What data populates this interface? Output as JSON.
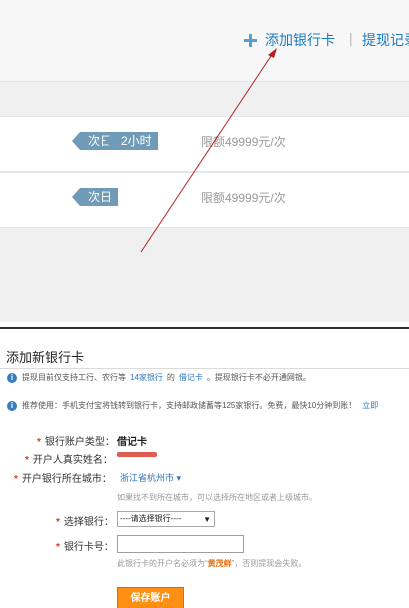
{
  "top": {
    "add_card": "添加银行卡",
    "separator": "|",
    "withdraw": "提现记录"
  },
  "rows": [
    {
      "tags": [
        "次日",
        "2小时"
      ],
      "limit": "限额49999元/次"
    },
    {
      "tags": [
        "次日"
      ],
      "limit": "限额49999元/次"
    }
  ],
  "dialog": {
    "title": "添加新银行卡",
    "notice1": {
      "text": "提现目前仅支持工行、农行等",
      "banks": "14家银行",
      "middle": "的",
      "card": "借记卡",
      "end": "。提现银行卡不必开通网银。"
    },
    "notice2": {
      "text": "推荐使用：手机支付宝将钱转到银行卡，支持邮政储蓄等125家银行。免费，最快10分钟到账！",
      "link": "立即"
    },
    "account_type": {
      "label": "银行账户类型：",
      "value": "借记卡"
    },
    "name": {
      "label": "开户人真实姓名："
    },
    "city": {
      "label": "开户银行所在城市：",
      "value": "浙江省杭州市",
      "hint": "如果找不到所在城市，可以选择所在地区或者上级城市。"
    },
    "bank": {
      "label": "选择银行：",
      "value": "----请选择银行----"
    },
    "card": {
      "label": "银行卡号：",
      "placeholder": "",
      "hint_prefix": "此银行卡的开户名必须为“",
      "hint_name": "黄茂鲜",
      "hint_suffix": "”，否则提现会失败。"
    },
    "save": "保存账户"
  }
}
